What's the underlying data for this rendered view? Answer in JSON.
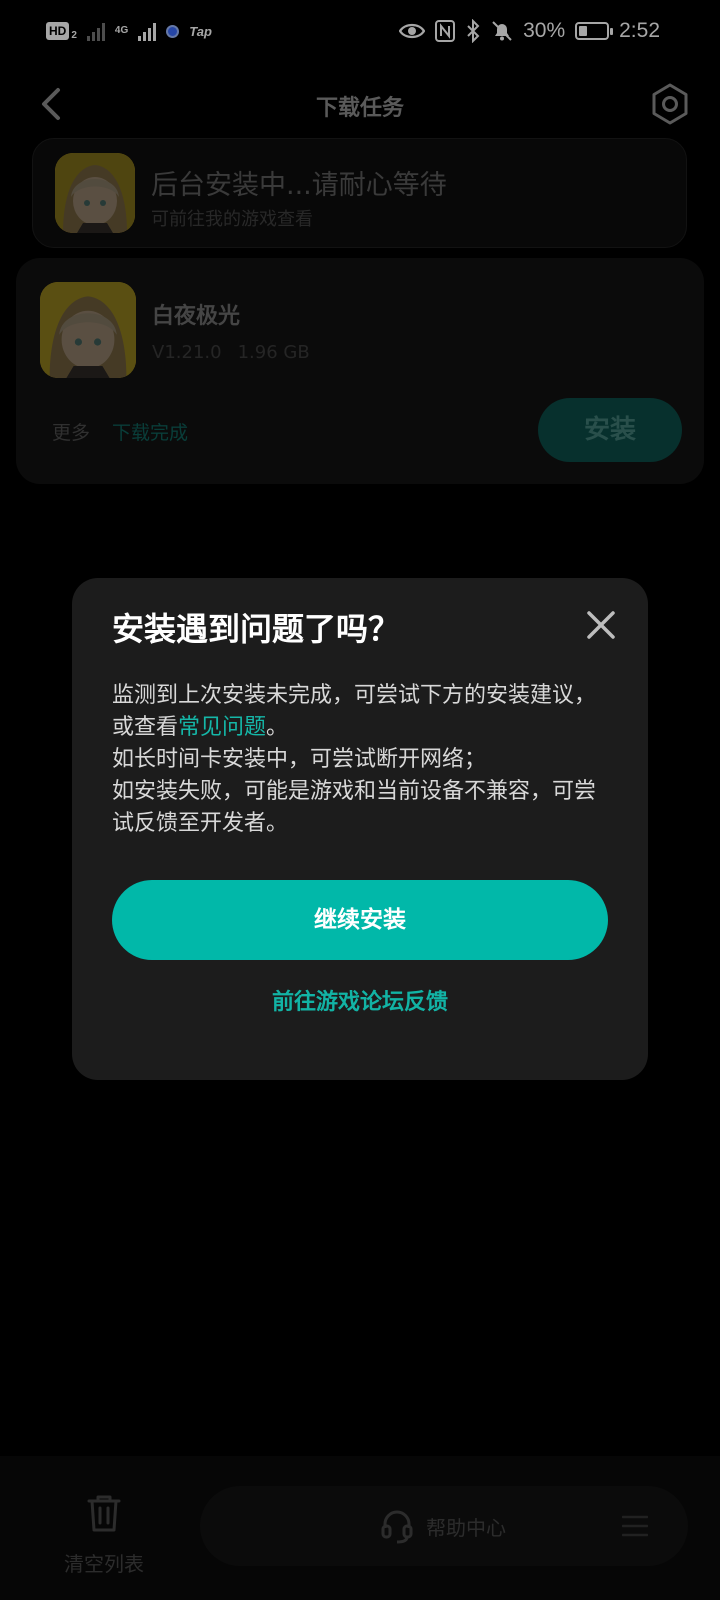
{
  "status_bar": {
    "hd_label": "HD",
    "hd_sub": "2",
    "network_label": "4G",
    "tap_label": "Tap",
    "battery_percent": "30%",
    "battery_level": 0.3,
    "time": "2:52"
  },
  "header": {
    "title": "下载任务"
  },
  "banner": {
    "title": "后台安装中...请耐心等待",
    "subtitle": "可前往我的游戏查看"
  },
  "task": {
    "name": "白夜极光",
    "version": "V1.21.0",
    "size": "1.96 GB",
    "more_label": "更多",
    "status": "下载完成",
    "install_label": "安装"
  },
  "dialog": {
    "title": "安装遇到问题了吗？",
    "body_line1_prefix": "监测到上次安装未完成，可尝试下方的安装建议，或查看",
    "faq_link": "常见问题",
    "body_line1_suffix": "。",
    "body_line2": "如长时间卡安装中，可尝试断开网络；",
    "body_line3": "如安装失败，可能是游戏和当前设备不兼容，可尝试反馈至开发者。",
    "continue_label": "继续安装",
    "forum_label": "前往游戏论坛反馈"
  },
  "bottom_bar": {
    "clear_label": "清空列表",
    "help_label": "帮助中心"
  },
  "colors": {
    "accent": "#01b8a9",
    "background": "#000000",
    "dialog_bg": "#1c1c1c"
  }
}
